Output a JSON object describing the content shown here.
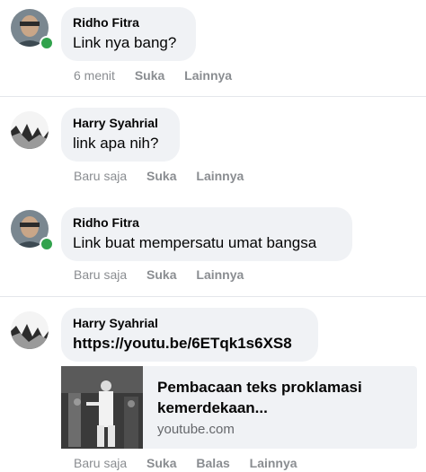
{
  "comments": [
    {
      "author": "Ridho Fitra",
      "text": "Link nya bang?",
      "meta": [
        "6 menit",
        "Suka",
        "Lainnya"
      ]
    },
    {
      "author": "Harry Syahrial",
      "text": "link apa nih?",
      "meta": [
        "Baru saja",
        "Suka",
        "Lainnya"
      ]
    },
    {
      "author": "Ridho Fitra",
      "text": "Link buat mempersatu umat bangsa",
      "meta": [
        "Baru saja",
        "Suka",
        "Lainnya"
      ]
    },
    {
      "author": "Harry Syahrial",
      "text": "https://youtu.be/6ETqk1s6XS8",
      "meta": [
        "Baru saja",
        "Suka",
        "Balas",
        "Lainnya"
      ],
      "link_preview": {
        "title": "Pembacaan teks proklamasi kemerdekaan...",
        "domain": "youtube.com"
      }
    }
  ],
  "colors": {
    "bubble": "#f0f2f5",
    "online": "#31a24c",
    "meta_text": "#8a8d91"
  },
  "icons": [
    "online-status-dot",
    "profile-avatar"
  ]
}
